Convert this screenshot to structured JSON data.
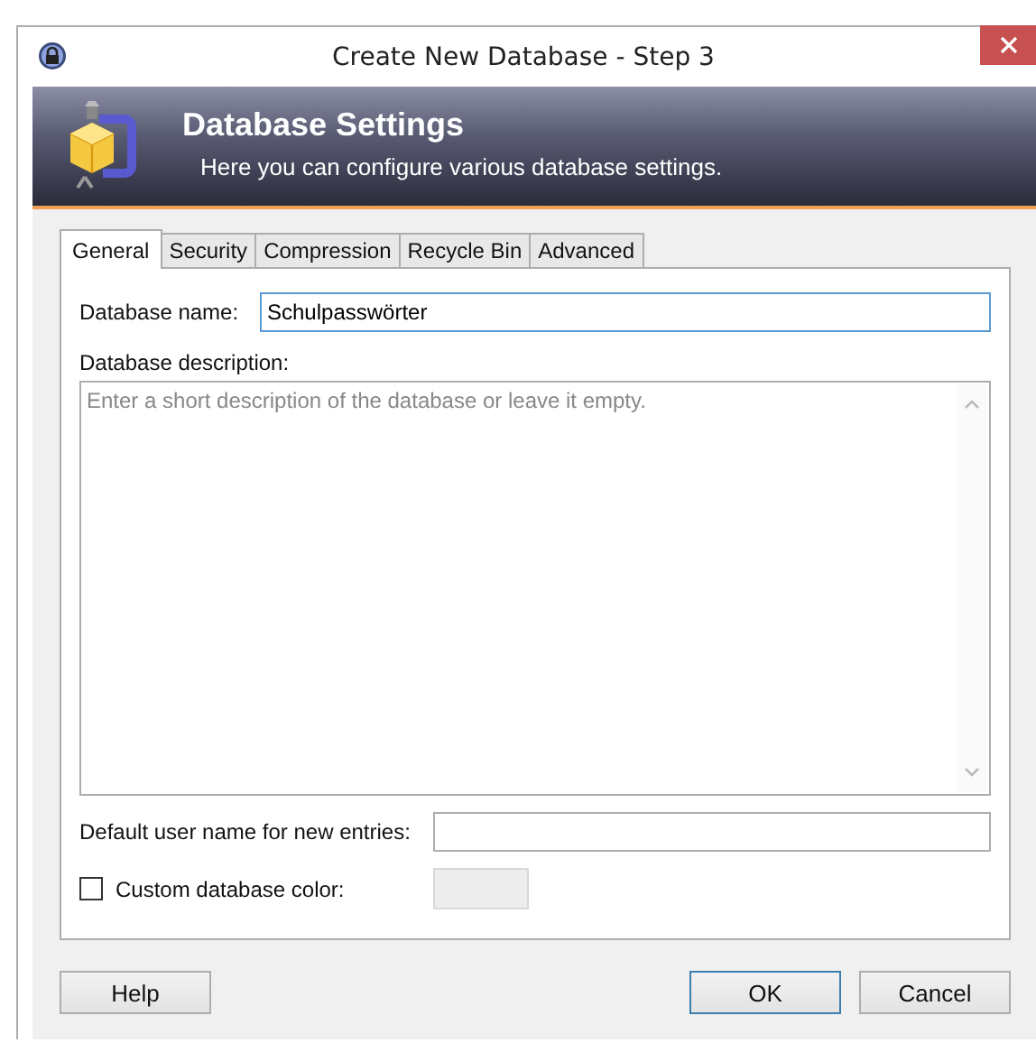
{
  "window": {
    "title": "Create New Database - Step 3"
  },
  "banner": {
    "title": "Database Settings",
    "subtitle": "Here you can configure various database settings."
  },
  "tabs": [
    {
      "label": "General",
      "selected": true
    },
    {
      "label": "Security",
      "selected": false
    },
    {
      "label": "Compression",
      "selected": false
    },
    {
      "label": "Recycle Bin",
      "selected": false
    },
    {
      "label": "Advanced",
      "selected": false
    }
  ],
  "general": {
    "name": {
      "label": "Database name:",
      "value": "Schulpasswörter",
      "focused": true
    },
    "description": {
      "label": "Database description:",
      "placeholder": "Enter a short description of the database or leave it empty."
    },
    "user_name": {
      "label": "Default user name for new entries:"
    },
    "custom_color": {
      "label": "Custom database color:",
      "checked": false
    }
  },
  "buttons": [
    {
      "label": "Help",
      "kind": "left",
      "default": false
    },
    {
      "label": "OK",
      "kind": "right",
      "default": true
    },
    {
      "label": "Cancel",
      "kind": "right",
      "default": false
    }
  ]
}
